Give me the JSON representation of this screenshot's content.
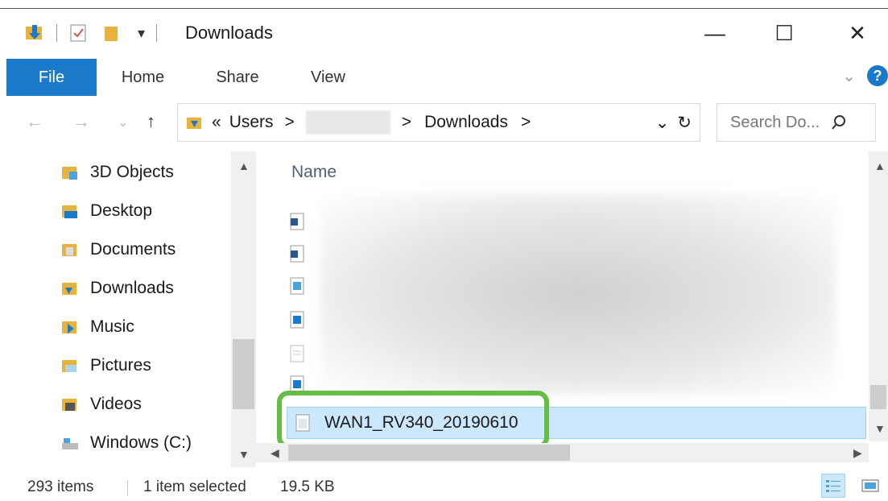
{
  "window": {
    "title": "Downloads",
    "minimize": "—",
    "maximize": "☐",
    "close": "✕"
  },
  "ribbon": {
    "tabs": [
      {
        "label": "File"
      },
      {
        "label": "Home"
      },
      {
        "label": "Share"
      },
      {
        "label": "View"
      }
    ],
    "expand": "⌄",
    "help": "?"
  },
  "nav": {
    "back": "←",
    "forward": "→",
    "recent": "⌄",
    "up": "↑",
    "address": {
      "prefix": "«",
      "segments": [
        "Users",
        "Downloads"
      ],
      "separator": ">",
      "dropdown": "⌄",
      "refresh": "↻"
    },
    "search_placeholder": "Search Do..."
  },
  "sidebar": {
    "items": [
      {
        "label": "3D Objects",
        "icon": "3d-objects-icon"
      },
      {
        "label": "Desktop",
        "icon": "desktop-icon"
      },
      {
        "label": "Documents",
        "icon": "documents-icon"
      },
      {
        "label": "Downloads",
        "icon": "downloads-icon"
      },
      {
        "label": "Music",
        "icon": "music-icon"
      },
      {
        "label": "Pictures",
        "icon": "pictures-icon"
      },
      {
        "label": "Videos",
        "icon": "videos-icon"
      },
      {
        "label": "Windows (C:)",
        "icon": "drive-icon"
      }
    ]
  },
  "filelist": {
    "column_name": "Name",
    "selected_file": "WAN1_RV340_20190610"
  },
  "status": {
    "item_count": "293 items",
    "selection": "1 item selected",
    "size": "19.5 KB"
  },
  "colors": {
    "accent": "#1979ca",
    "selection_bg": "#cce8ff",
    "highlight_ring": "#64bd45",
    "folder": "#e8b33c"
  }
}
